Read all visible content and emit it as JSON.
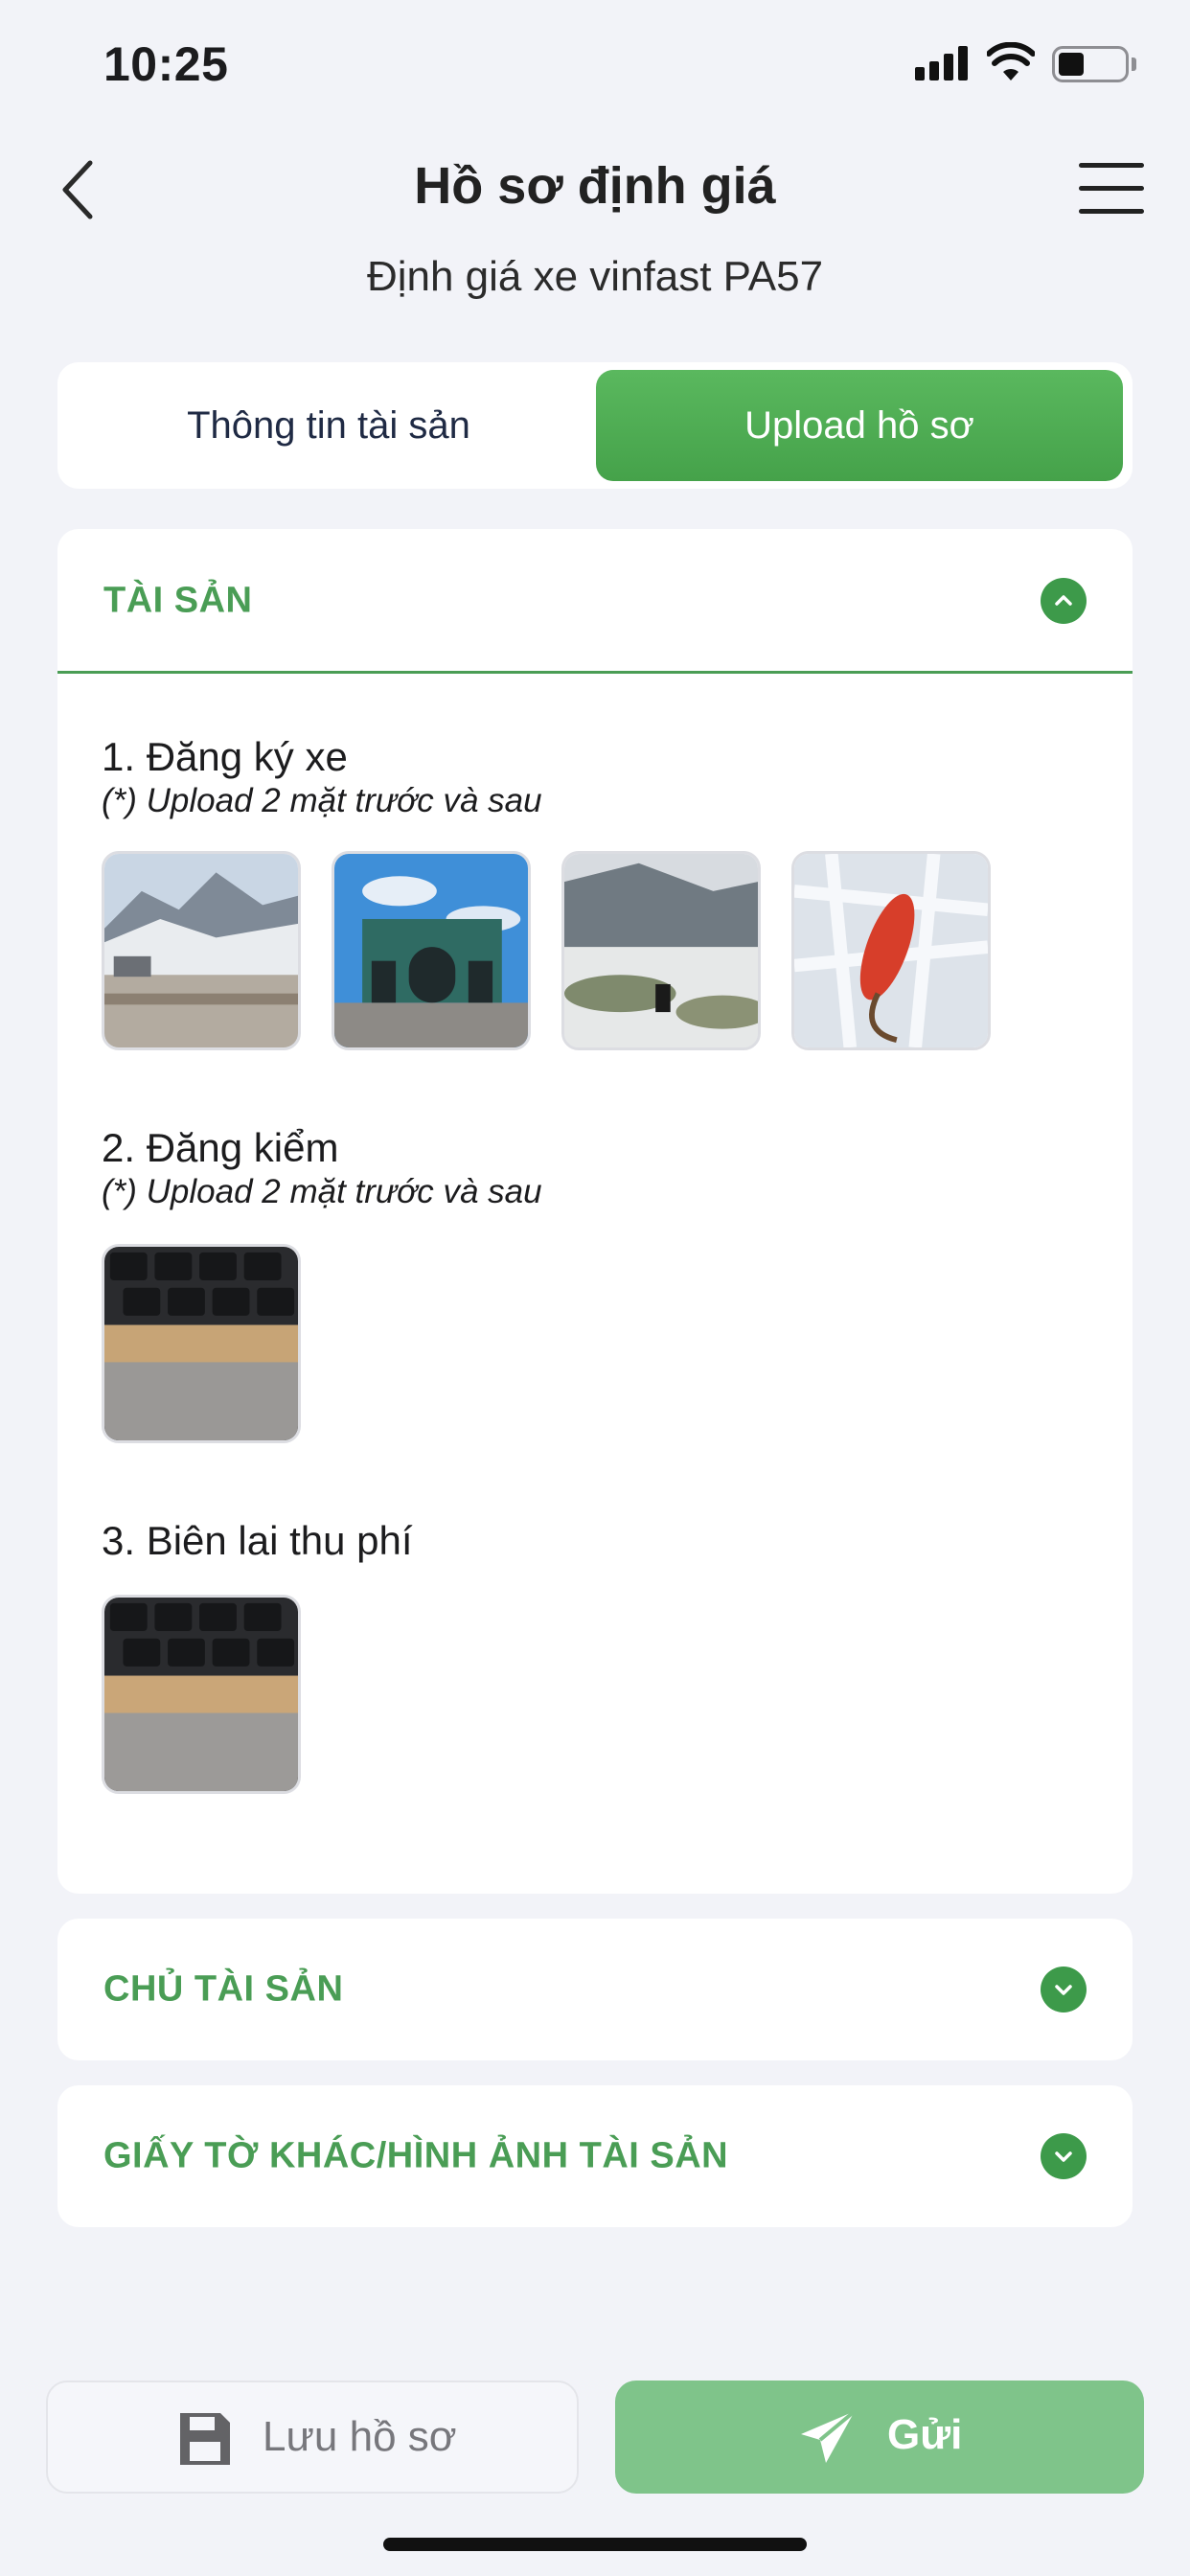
{
  "status_bar": {
    "time": "10:25"
  },
  "header": {
    "title": "Hồ sơ định giá",
    "subtitle": "Định giá xe vinfast PA57"
  },
  "tabs": [
    {
      "label": "Thông tin tài sản",
      "active": false
    },
    {
      "label": "Upload hồ sơ",
      "active": true
    }
  ],
  "sections": {
    "tai_san": {
      "title": "TÀI SẢN",
      "expanded": true,
      "groups": [
        {
          "title": "1. Đăng ký xe",
          "note": "(*) Upload 2 mặt trước và sau",
          "images": [
            "mountain-snow-photo",
            "temple-gate-photo",
            "snowy-hill-photo",
            "red-berries-in-ice-photo"
          ]
        },
        {
          "title": "2. Đăng kiểm",
          "note": "(*) Upload 2 mặt trước và sau",
          "images": [
            "laptop-keyboard-photo"
          ]
        },
        {
          "title": "3. Biên lai thu phí",
          "note": "",
          "images": [
            "laptop-keyboard-photo"
          ]
        }
      ]
    },
    "chu_tai_san": {
      "title": "CHỦ TÀI SẢN",
      "expanded": false
    },
    "giay_to_khac": {
      "title": "GIẤY TỜ KHÁC/HÌNH ẢNH TÀI SẢN",
      "expanded": false
    }
  },
  "actions": {
    "save_label": "Lưu hồ sơ",
    "send_label": "Gửi"
  },
  "colors": {
    "accent": "#4a9d55",
    "tab_active": "#4fad54",
    "send_button": "#7fc48a",
    "background": "#f2f3f8"
  }
}
